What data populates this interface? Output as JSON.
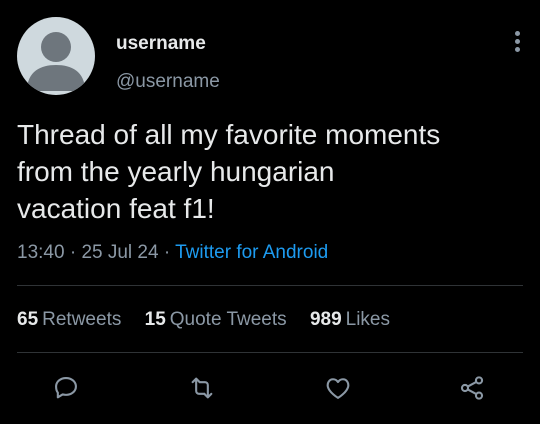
{
  "user": {
    "display_name": "username",
    "handle": "@username"
  },
  "tweet": {
    "text": "Thread of all my favorite moments\nfrom the yearly hungarian\nvacation feat f1!",
    "time": "13:40",
    "separator": "·",
    "date": "25 Jul 24",
    "source": "Twitter for Android"
  },
  "stats": {
    "retweets": {
      "count": "65",
      "label": "Retweets"
    },
    "quote_tweets": {
      "count": "15",
      "label": "Quote Tweets"
    },
    "likes": {
      "count": "989",
      "label": "Likes"
    }
  },
  "actions": {
    "icons": [
      "reply-icon",
      "retweet-icon",
      "like-icon",
      "share-icon"
    ]
  },
  "colors": {
    "background": "#000000",
    "primary_text": "#e7e9ea",
    "secondary_text": "#8b98a5",
    "link": "#1d9bf0",
    "divider": "#2f3336",
    "avatar_bg": "#cfd9de",
    "avatar_fg": "#6e767d"
  }
}
